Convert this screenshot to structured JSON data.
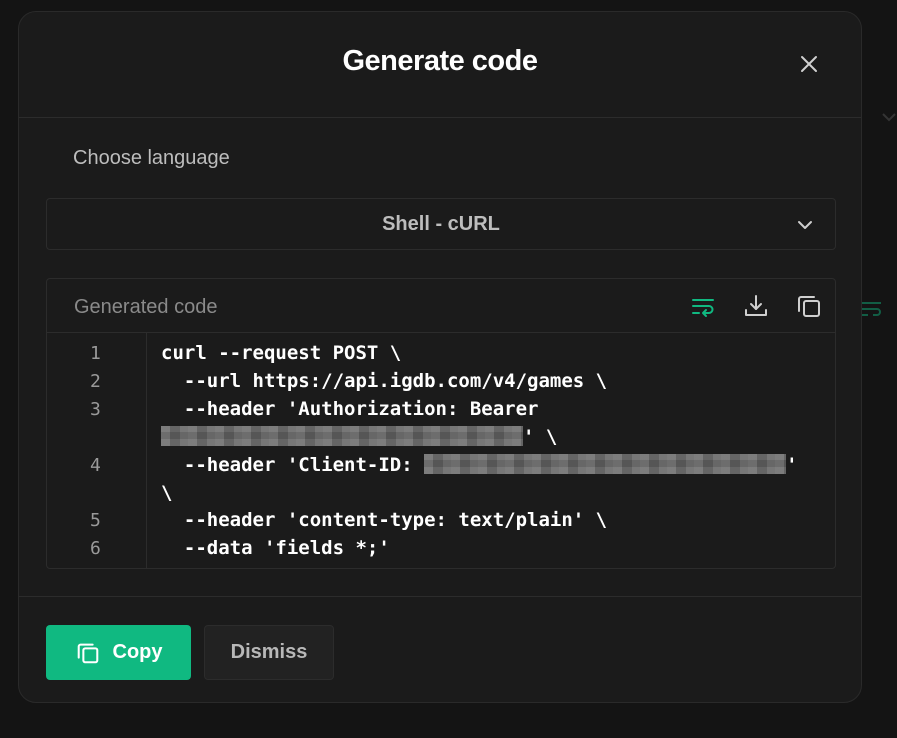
{
  "modal": {
    "title": "Generate code",
    "close_icon": "close-icon"
  },
  "language": {
    "label": "Choose language",
    "selected": "Shell - cURL"
  },
  "code_panel": {
    "title": "Generated code",
    "tools": [
      "wrap-lines-icon",
      "download-icon",
      "copy-icon"
    ],
    "line_numbers": [
      "1",
      "2",
      "3",
      "4",
      "5",
      "6"
    ],
    "lines": [
      "curl --request POST \\",
      "  --url https://api.igdb.com/v4/games \\",
      "  --header 'Authorization: Bearer",
      "' \\",
      "  --header 'Client-ID: ",
      "'",
      "\\",
      "  --header 'content-type: text/plain' \\",
      "  --data 'fields *;'"
    ]
  },
  "footer": {
    "copy_label": "Copy",
    "dismiss_label": "Dismiss"
  },
  "colors": {
    "accent": "#10b981",
    "background": "#1b1b1b",
    "border": "#2c2c2c"
  }
}
